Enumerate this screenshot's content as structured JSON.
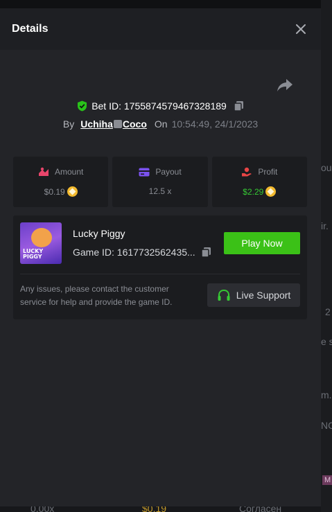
{
  "modal": {
    "title": "Details"
  },
  "bet": {
    "label": "Bet ID: 1755874579467328189",
    "by_label": "By",
    "user_part1": "Uchiha",
    "user_part2": "Coco",
    "on_label": "On",
    "time": "10:54:49, 24/1/2023"
  },
  "stats": {
    "amount_label": "Amount",
    "amount_value": "$0.19",
    "payout_label": "Payout",
    "payout_value": "12.5 x",
    "profit_label": "Profit",
    "profit_value": "$2.29"
  },
  "game": {
    "name": "Lucky Piggy",
    "id_label": "Game ID: 1617732562435...",
    "thumb_text_line1": "LUCKY",
    "thumb_text_line2": "PIGGY",
    "play_label": "Play Now",
    "issue_text": "Any issues, please contact the customer service for help and provide the game ID.",
    "support_label": "Live Support"
  },
  "background": {
    "side_texts": [
      "ou",
      "ir.",
      "2",
      "e s",
      "m.",
      "NG",
      "M"
    ],
    "bottom_left": "0.00x",
    "bottom_mid": "$0.19",
    "bottom_right": "Согласен"
  },
  "colors": {
    "accent_green": "#3bc117",
    "profit_green": "#36c934",
    "amount_pink": "#e8456b",
    "payout_purple": "#7b52f0",
    "profit_red": "#e84545",
    "coin_gold": "#f3ba2f"
  },
  "icons": [
    "close-icon",
    "share-icon",
    "verified-shield-icon",
    "copy-icon",
    "dice-icon",
    "amount-icon",
    "payout-card-icon",
    "profit-hand-icon",
    "headset-icon",
    "coin-icon"
  ]
}
